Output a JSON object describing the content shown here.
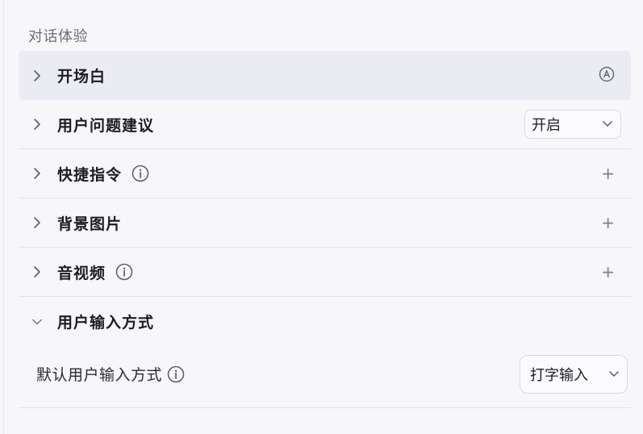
{
  "section": {
    "title": "对话体验"
  },
  "rows": [
    {
      "label": "开场白",
      "action": "auto-icon",
      "expanded": false,
      "active": true
    },
    {
      "label": "用户问题建议",
      "action": "select",
      "value": "开启",
      "expanded": false
    },
    {
      "label": "快捷指令",
      "action": "plus",
      "info": true,
      "expanded": false
    },
    {
      "label": "背景图片",
      "action": "plus",
      "expanded": false
    },
    {
      "label": "音视频",
      "action": "plus",
      "info": true,
      "expanded": false
    },
    {
      "label": "用户输入方式",
      "expanded": true
    }
  ],
  "input_mode": {
    "label": "默认用户输入方式",
    "value": "打字输入"
  },
  "icons": {
    "plus": "+",
    "chevron_right": "chevron-right-icon",
    "chevron_down": "chevron-down-icon",
    "info": "info-icon",
    "auto": "auto-a-icon"
  },
  "colors": {
    "background": "#f7f7fa",
    "active_row": "#ebebf3",
    "text": "#1d1c23",
    "muted": "#6b6b7b"
  }
}
